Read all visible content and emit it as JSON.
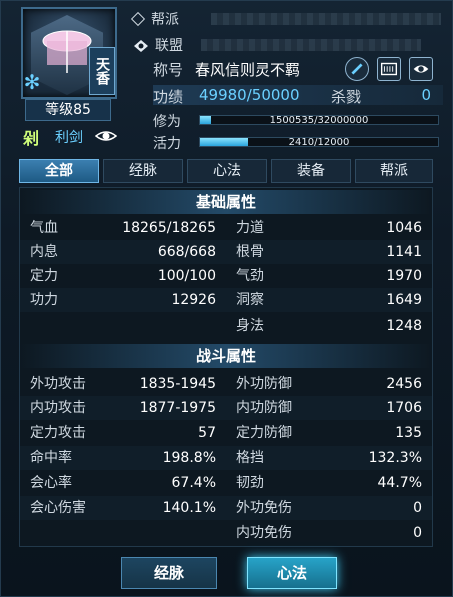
{
  "header": {
    "school": "天香",
    "level": "等级85",
    "weapon_glyph": "剁",
    "weapon": "利剑",
    "guild_label": "帮派",
    "alliance_label": "联盟",
    "title_label": "称号",
    "title_value": "春风信则灵不羁",
    "merit_label": "功绩",
    "merit_value": "49980/50000",
    "slay_label": "杀戮",
    "slay_value": "0",
    "cultivation_label": "修为",
    "cultivation_value": "1500535/32000000",
    "cultivation_fraction": 0.047,
    "vitality_label": "活力",
    "vitality_value": "2410/12000",
    "vitality_fraction": 0.2
  },
  "tabs": [
    {
      "label": "全部",
      "active": true
    },
    {
      "label": "经脉",
      "active": false
    },
    {
      "label": "心法",
      "active": false
    },
    {
      "label": "装备",
      "active": false
    },
    {
      "label": "帮派",
      "active": false
    }
  ],
  "basic": {
    "heading": "基础属性",
    "left": [
      {
        "k": "气血",
        "v": "18265/18265"
      },
      {
        "k": "内息",
        "v": "668/668"
      },
      {
        "k": "定力",
        "v": "100/100"
      },
      {
        "k": "功力",
        "v": "12926"
      }
    ],
    "right": [
      {
        "k": "力道",
        "v": "1046"
      },
      {
        "k": "根骨",
        "v": "1141"
      },
      {
        "k": "气劲",
        "v": "1970"
      },
      {
        "k": "洞察",
        "v": "1649"
      },
      {
        "k": "身法",
        "v": "1248"
      }
    ]
  },
  "combat": {
    "heading": "战斗属性",
    "left": [
      {
        "k": "外功攻击",
        "v": "1835-1945"
      },
      {
        "k": "内功攻击",
        "v": "1877-1975"
      },
      {
        "k": "定力攻击",
        "v": "57"
      },
      {
        "k": "命中率",
        "v": "198.8%"
      },
      {
        "k": "会心率",
        "v": "67.4%"
      },
      {
        "k": "会心伤害",
        "v": "140.1%"
      }
    ],
    "right": [
      {
        "k": "外功防御",
        "v": "2456"
      },
      {
        "k": "内功防御",
        "v": "1706"
      },
      {
        "k": "定力防御",
        "v": "135"
      },
      {
        "k": "格挡",
        "v": "132.3%"
      },
      {
        "k": "韧劲",
        "v": "44.7%"
      },
      {
        "k": "外功免伤",
        "v": "0"
      },
      {
        "k": "内功免伤",
        "v": "0"
      }
    ]
  },
  "footer": {
    "meridian_button": "经脉",
    "mind_button": "心法"
  },
  "colors": {
    "accent": "#6bd0ff",
    "active_tab": "#2a6d9c"
  }
}
